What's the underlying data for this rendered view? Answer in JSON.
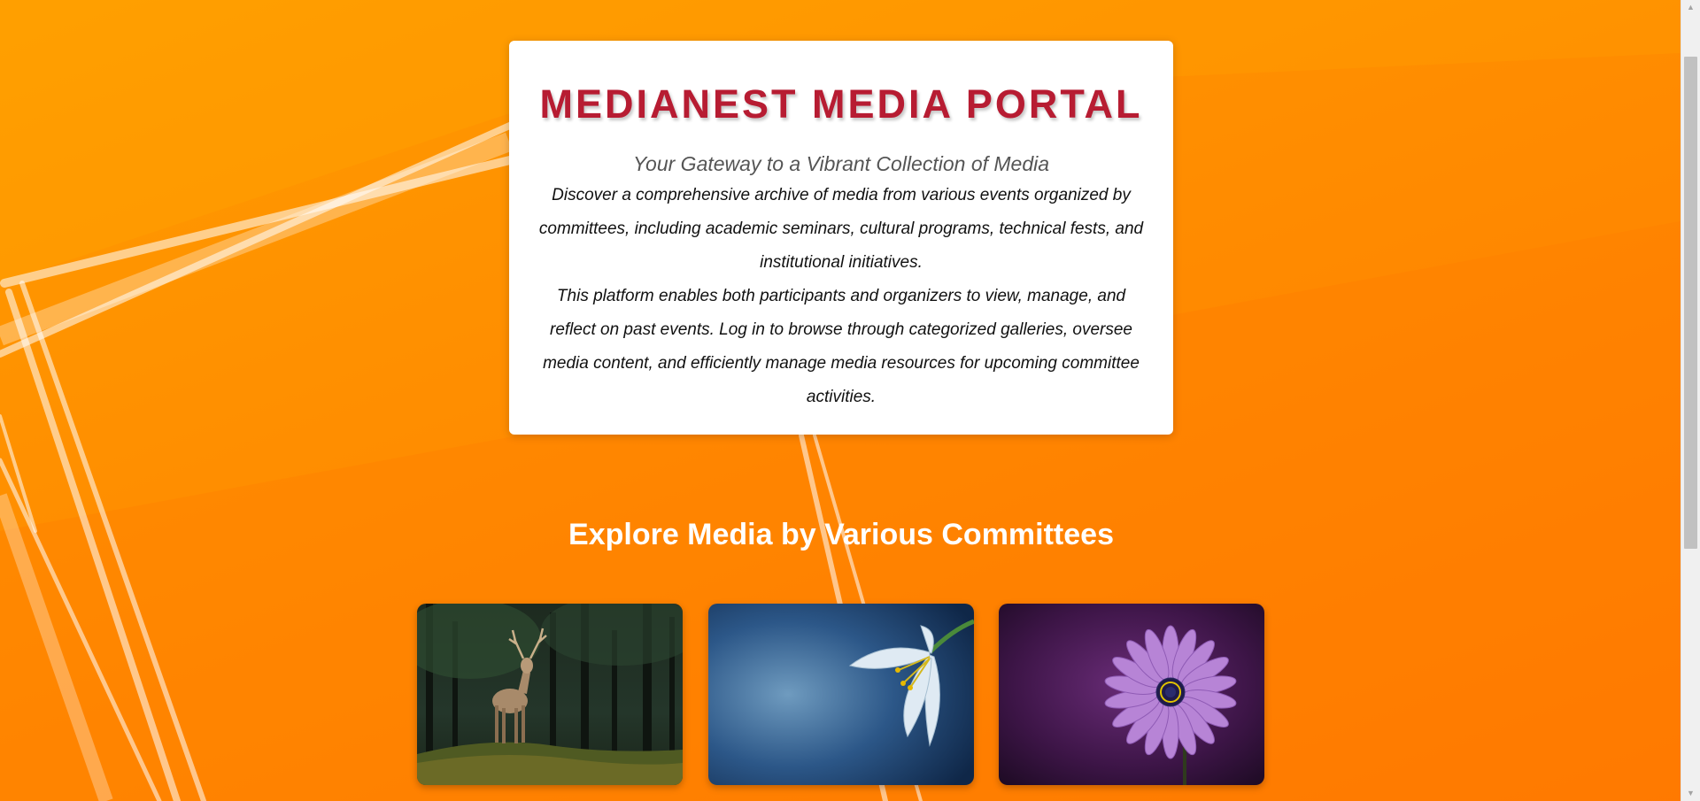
{
  "hero": {
    "title": "MEDIANEST MEDIA PORTAL",
    "subtitle": "Your Gateway to a Vibrant Collection of Media",
    "description_1": "Discover a comprehensive archive of media from various events organized by committees, including academic seminars, cultural programs, technical fests, and institutional initiatives.",
    "description_2": "This platform enables both participants and organizers to view, manage, and reflect on past events. Log in to browse through categorized galleries, oversee media content, and efficiently manage media resources for upcoming committee activities."
  },
  "committees": {
    "heading": "Explore Media by Various Committees",
    "cards": [
      {
        "image": "deer-in-forest-photo"
      },
      {
        "image": "white-lily-on-blue-photo"
      },
      {
        "image": "purple-daisy-photo"
      }
    ]
  },
  "colors": {
    "background": "#ff8c00",
    "title": "#b71c32",
    "card": "#ffffff"
  },
  "icons": {
    "scroll_up": "up-arrow-icon",
    "scroll_down": "down-arrow-icon"
  }
}
